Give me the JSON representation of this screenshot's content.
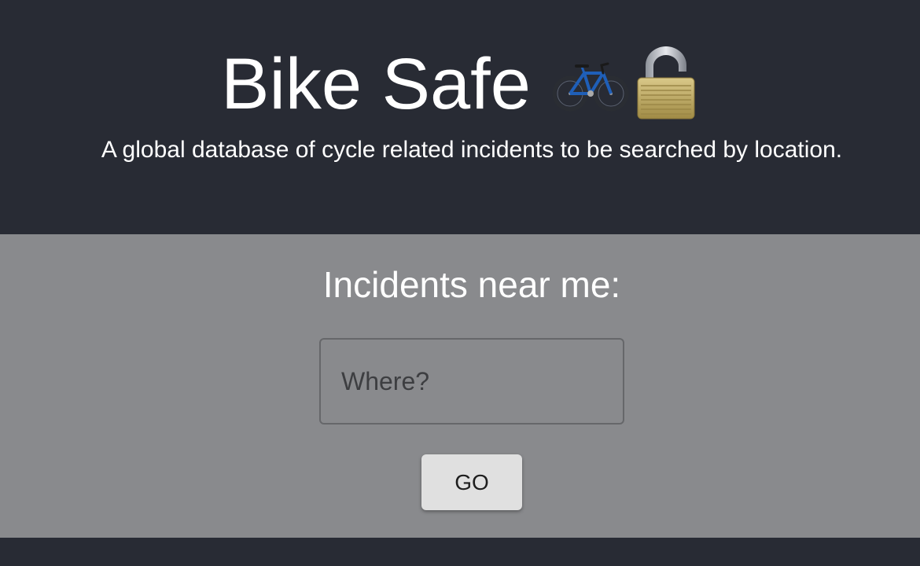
{
  "header": {
    "title": "Bike Safe",
    "title_icons": [
      "bicycle-icon",
      "padlock-icon"
    ],
    "subtitle": "A global database of cycle related incidents to be searched by location."
  },
  "search": {
    "heading": "Incidents near me:",
    "placeholder": "Where?",
    "value": "",
    "button_label": "GO"
  },
  "colors": {
    "header_background": "#282b34",
    "panel_background": "#898a8d",
    "button_background": "#e0e0e0",
    "bike_frame": "#1f5fb8",
    "lock_body": "#c9b56a"
  }
}
